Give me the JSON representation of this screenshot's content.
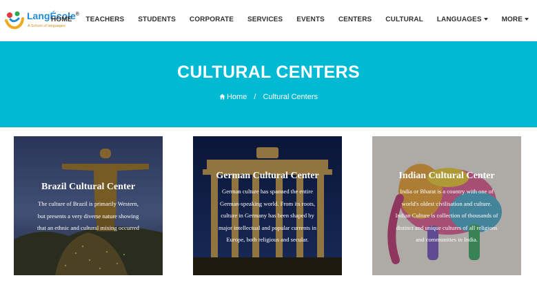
{
  "brand": {
    "name": "LangÉcole",
    "registered_mark": "®",
    "tagline": "A School of languages"
  },
  "nav": {
    "items": [
      {
        "label": "HOME",
        "dropdown": false
      },
      {
        "label": "TEACHERS",
        "dropdown": false
      },
      {
        "label": "STUDENTS",
        "dropdown": false
      },
      {
        "label": "CORPORATE",
        "dropdown": false
      },
      {
        "label": "SERVICES",
        "dropdown": false
      },
      {
        "label": "EVENTS",
        "dropdown": false
      },
      {
        "label": "CENTERS",
        "dropdown": false
      },
      {
        "label": "CULTURAL",
        "dropdown": false
      },
      {
        "label": "LANGUAGES",
        "dropdown": true
      },
      {
        "label": "MORE",
        "dropdown": true
      }
    ]
  },
  "banner": {
    "title": "CULTURAL CENTERS",
    "breadcrumb_home": "Home",
    "breadcrumb_separator": "/",
    "breadcrumb_current": "Cultural Centers",
    "background_color": "#00b9d3"
  },
  "cards": [
    {
      "title": "Brazil Cultural Center",
      "lines": [
        "The culture of Brazil is primarily Western,",
        "but presents a very diverse nature showing",
        "that an ethnic and cultural mixing occurred"
      ]
    },
    {
      "title": "German Cultural Center",
      "lines": [
        "German culture has spanned the entire",
        "German-speaking world. From its roots,",
        "culture in Germany has been shaped by",
        "major intellectual and popular currents in",
        "Europe, both religious and secular."
      ]
    },
    {
      "title": "Indian Cultural Center",
      "lines": [
        "India or Bharat is a country with one of",
        "world's oldest civilisation and culture.",
        "Indian Culture is collection of thousands of",
        "distinct and unique cultures of all religions",
        "and communities in India."
      ]
    }
  ]
}
